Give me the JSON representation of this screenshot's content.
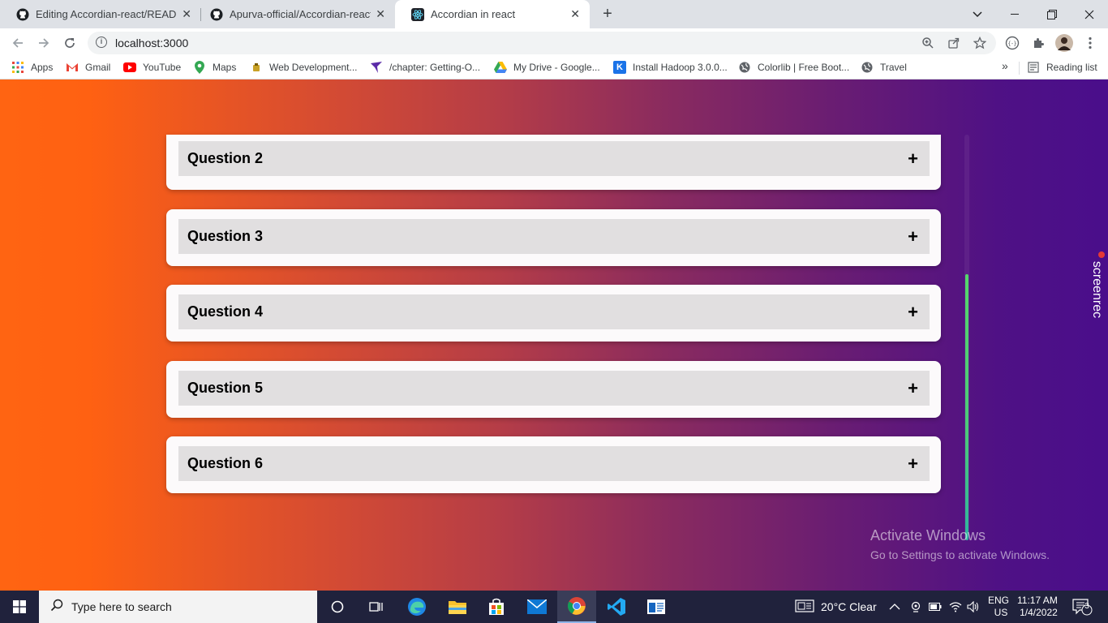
{
  "browser": {
    "tabs": [
      {
        "title": "Editing Accordian-react/README",
        "icon": "github-icon"
      },
      {
        "title": "Apurva-official/Accordian-react",
        "icon": "github-icon"
      },
      {
        "title": "Accordian in react",
        "icon": "react-icon",
        "active": true
      }
    ],
    "url": "localhost:3000",
    "bookmarks": [
      {
        "label": "Apps",
        "icon": "apps-grid-icon"
      },
      {
        "label": "Gmail",
        "icon": "gmail-icon"
      },
      {
        "label": "YouTube",
        "icon": "youtube-icon"
      },
      {
        "label": "Maps",
        "icon": "maps-icon"
      },
      {
        "label": "Web Development...",
        "icon": "folder-icon"
      },
      {
        "label": "/chapter: Getting-O...",
        "icon": "bird-icon"
      },
      {
        "label": "My Drive - Google...",
        "icon": "drive-icon"
      },
      {
        "label": "Install Hadoop 3.0.0...",
        "icon": "k-icon"
      },
      {
        "label": "Colorlib | Free Boot...",
        "icon": "globe-icon"
      },
      {
        "label": "Travel",
        "icon": "globe-icon"
      }
    ],
    "more_label": "»",
    "reading_list": "Reading list"
  },
  "accordion": {
    "items": [
      {
        "title": "Question 2",
        "toggle": "+"
      },
      {
        "title": "Question 3",
        "toggle": "+"
      },
      {
        "title": "Question 4",
        "toggle": "+"
      },
      {
        "title": "Question 5",
        "toggle": "+"
      },
      {
        "title": "Question 6",
        "toggle": "+"
      }
    ]
  },
  "overlay": {
    "screenrec": "screenrec",
    "activate_title": "Activate Windows",
    "activate_sub": "Go to Settings to activate Windows."
  },
  "taskbar": {
    "search_placeholder": "Type here to search",
    "weather": "20°C  Clear",
    "lang_top": "ENG",
    "lang_bottom": "US",
    "time": "11:17 AM",
    "date": "1/4/2022",
    "notif_count": "3"
  },
  "colors": {
    "gradient_start": "#ff6412",
    "gradient_end": "#4a0e8b",
    "card": "#fcfafb",
    "header": "#e1dfe0",
    "scroll_thumb": "#4cc87a"
  }
}
